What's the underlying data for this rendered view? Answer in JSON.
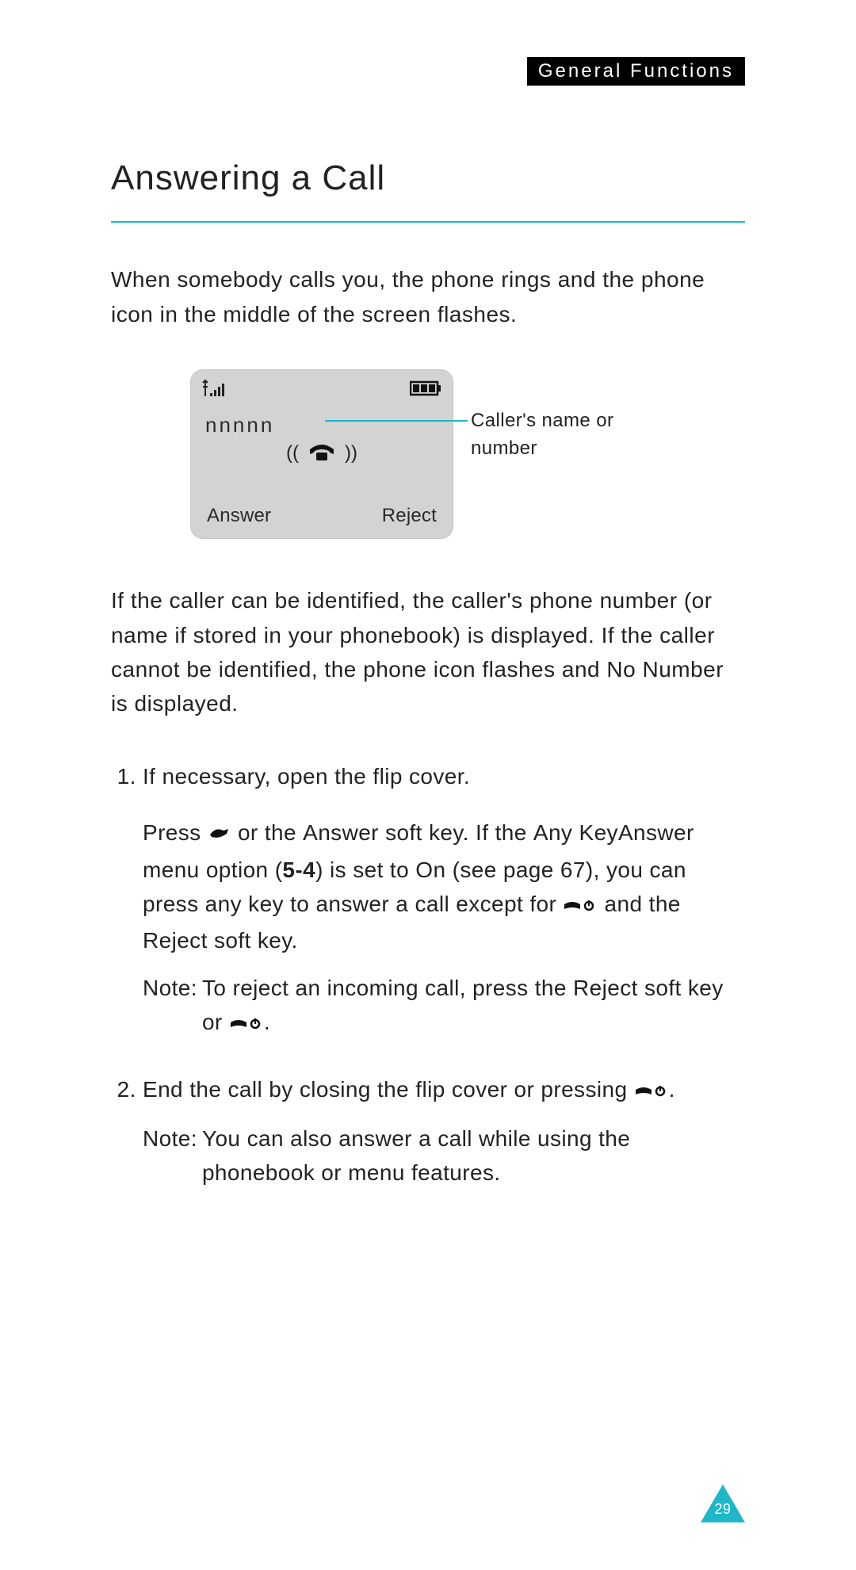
{
  "header": {
    "section": "General Functions"
  },
  "title": "Answering a Call",
  "intro": "When somebody calls you, the phone rings and the phone icon in the middle of the screen flashes.",
  "screen": {
    "caller_placeholder": "nnnnn",
    "softkey_left": "Answer",
    "softkey_right": "Reject",
    "annotation": "Caller's name or number"
  },
  "para2_a": "If the caller can be identified, the caller's phone number (or name if stored in your phonebook) is displayed. If the caller cannot be identified, the phone icon flashes and ",
  "para2_lit": "No Number",
  "para2_b": " is displayed.",
  "step1": {
    "head": "If necessary, open the flip cover.",
    "press_a": "Press ",
    "press_b": " or the ",
    "lit_answer": "Answer",
    "press_c": " soft key. If the ",
    "lit_anykey": "Any KeyAnswer",
    "press_d": " menu option (",
    "menu_ref": "5-4",
    "press_e": ") is set to ",
    "lit_on": "On",
    "press_f": " (see page 67), you can press any key to answer a call except for ",
    "press_g": " and the ",
    "lit_reject": "Reject",
    "press_h": " soft key.",
    "note_label": "Note:",
    "note_a": "To reject an incoming call, press the Reject soft key or ",
    "note_b": "."
  },
  "step2": {
    "head_a": "End the call by closing the flip cover or pressing ",
    "head_b": ".",
    "note_label": "Note:",
    "note_body": "You can also answer a call while using the phonebook or menu features."
  },
  "page_number": "29"
}
